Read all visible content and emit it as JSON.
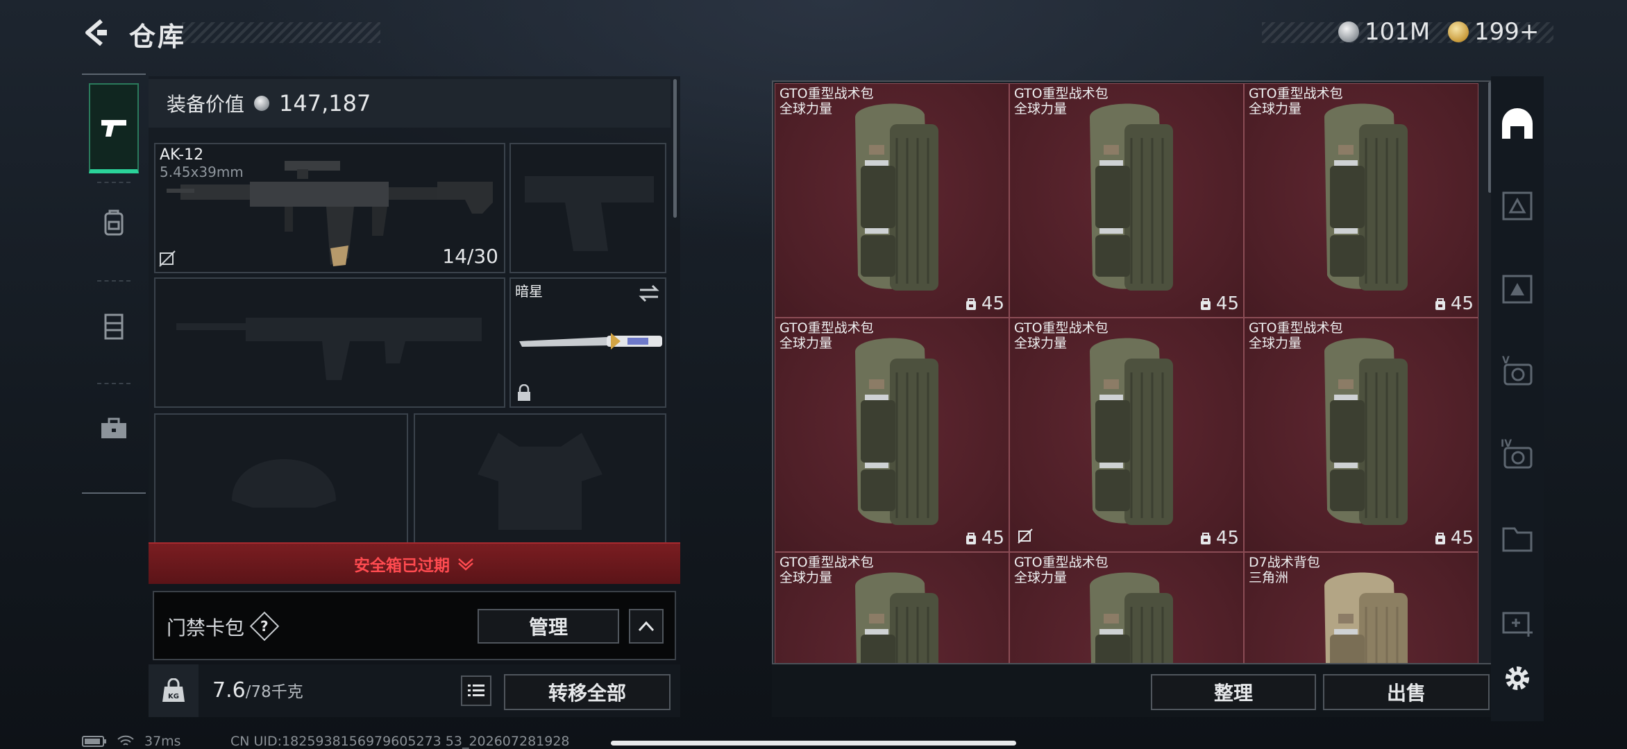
{
  "header": {
    "title": "仓库",
    "currency_1": "101M",
    "currency_2": "199+"
  },
  "sidebar": {
    "tabs": [
      {
        "icon": "pistol-icon",
        "active": true
      },
      {
        "icon": "backpack-icon",
        "active": false
      },
      {
        "icon": "vest-icon",
        "active": false
      },
      {
        "icon": "toolbox-icon",
        "active": false
      }
    ]
  },
  "equipment": {
    "value_label": "装备价值",
    "value": "147,187",
    "primary_weapon": {
      "name": "AK-12",
      "caliber": "5.45x39mm",
      "ammo": "14/30"
    },
    "melee": {
      "name": "暗星"
    },
    "safe_box_status": "安全箱已过期",
    "card_bag_label": "门禁卡包",
    "card_bag_help": "?",
    "manage_label": "管理",
    "weight": "7.6",
    "weight_capacity": "/78千克",
    "transfer_all_label": "转移全部"
  },
  "warehouse": {
    "items": [
      {
        "name": "GTO重型战术包",
        "tag": "全球力量",
        "count": "45",
        "locked": false
      },
      {
        "name": "GTO重型战术包",
        "tag": "全球力量",
        "count": "45",
        "locked": false
      },
      {
        "name": "GTO重型战术包",
        "tag": "全球力量",
        "count": "45",
        "locked": false
      },
      {
        "name": "GTO重型战术包",
        "tag": "全球力量",
        "count": "45",
        "locked": false
      },
      {
        "name": "GTO重型战术包",
        "tag": "全球力量",
        "count": "45",
        "locked": true
      },
      {
        "name": "GTO重型战术包",
        "tag": "全球力量",
        "count": "45",
        "locked": false
      },
      {
        "name": "GTO重型战术包",
        "tag": "全球力量",
        "count": "",
        "locked": false
      },
      {
        "name": "GTO重型战术包",
        "tag": "全球力量",
        "count": "",
        "locked": false
      },
      {
        "name": "D7战术背包",
        "tag": "三角洲",
        "count": "",
        "locked": false
      }
    ],
    "sort_label": "整理",
    "sell_label": "出售"
  },
  "filters": [
    "helmet-icon",
    "armor-level-1-icon",
    "armor-level-2-icon",
    "armor-level-5-icon",
    "armor-level-4-icon",
    "folder-icon",
    "medkit-icon",
    "settings-icon"
  ],
  "status": {
    "ping": "37ms",
    "uid": "CN UID:1825938156979605273 53_202607281928"
  },
  "colors": {
    "accent": "#2bd39a",
    "warning": "#ff4b50",
    "item_bg": "#561f27"
  }
}
